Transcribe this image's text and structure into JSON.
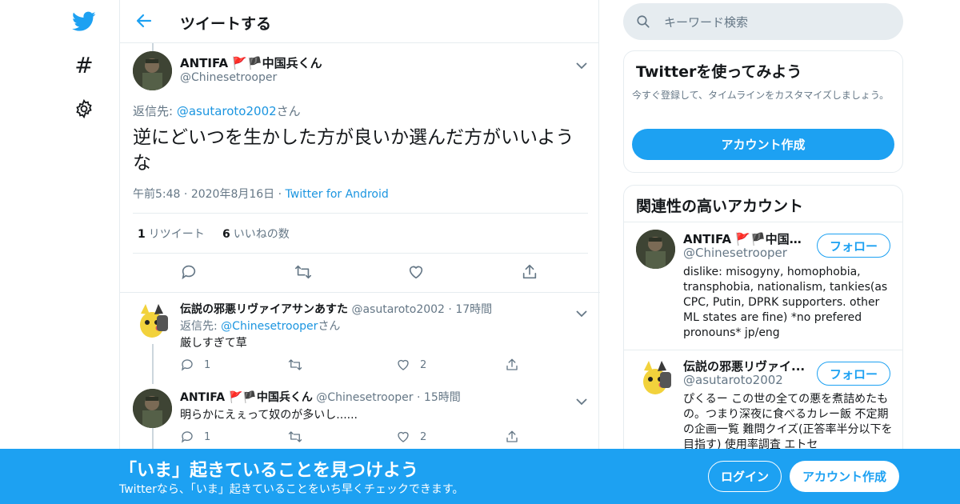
{
  "colors": {
    "brand": "#1da1f2",
    "text": "#14171a",
    "muted": "#657786",
    "border": "#e6ecf0"
  },
  "nav": {
    "icons": [
      "twitter-bird-icon",
      "hashtag-icon",
      "gear-icon"
    ],
    "hash_glyph": "#"
  },
  "header": {
    "title": "ツイートする"
  },
  "main_tweet": {
    "name": "ANTIFA 🚩🏴中国兵くん",
    "handle": "@Chinesetrooper",
    "reply_prefix": "返信先: ",
    "reply_to": "@asutaroto2002",
    "reply_suffix": "さん",
    "text": "逆にどいつを生かした方が良いか選んだ方がいいような",
    "time": "午前5:48",
    "date": "2020年8月16日",
    "source": "Twitter for Android",
    "sep": "·",
    "retweet_count": "1",
    "retweet_label": "リツイート",
    "like_count": "6",
    "like_label": "いいねの数"
  },
  "replies": [
    {
      "name": "伝説の邪悪リヴァイアサンあすた",
      "handle": "@asutaroto2002",
      "sep": "·",
      "time": "17時間",
      "reply_prefix": "返信先: ",
      "reply_to": "@Chinesetrooper",
      "reply_suffix": "さん",
      "text": "厳しすぎて草",
      "reply_count": "1",
      "retweet_count": "",
      "like_count": "2"
    },
    {
      "name": "ANTIFA 🚩🏴中国兵くん",
      "handle": "@Chinesetrooper",
      "sep": "·",
      "time": "15時間",
      "text": "明らかにえぇって奴のが多いし......",
      "reply_count": "1",
      "retweet_count": "",
      "like_count": "2"
    }
  ],
  "search": {
    "placeholder": "キーワード検索"
  },
  "signup_card": {
    "title": "Twitterを使ってみよう",
    "desc": "今すぐ登録して、タイムラインをカスタマイズしましょう。",
    "button": "アカウント作成"
  },
  "related": {
    "title": "関連性の高いアカウント",
    "accounts": [
      {
        "name": "ANTIFA 🚩🏴中国兵...",
        "handle": "@Chinesetrooper",
        "follow": "フォロー",
        "bio": "dislike: misogyny, homophobia, transphobia, nationalism, tankies(as CPC, Putin, DPRK supporters. other ML states are fine) *no prefered pronouns* jp/eng"
      },
      {
        "name": "伝説の邪悪リヴァイ...",
        "handle": "@asutaroto2002",
        "follow": "フォロー",
        "bio": "ぴくるー この世の全ての悪を煮詰めたもの。つまり深夜に食べるカレー飯 不定期の企画一覧 難問クイズ(正答率半分以下を目指す) 使用率調査 エトセ"
      }
    ]
  },
  "banner": {
    "title": "「いま」起きていることを見つけよう",
    "subtitle": "Twitterなら、「いま」起きていることをいち早くチェックできます。",
    "login": "ログイン",
    "signup": "アカウント作成"
  }
}
